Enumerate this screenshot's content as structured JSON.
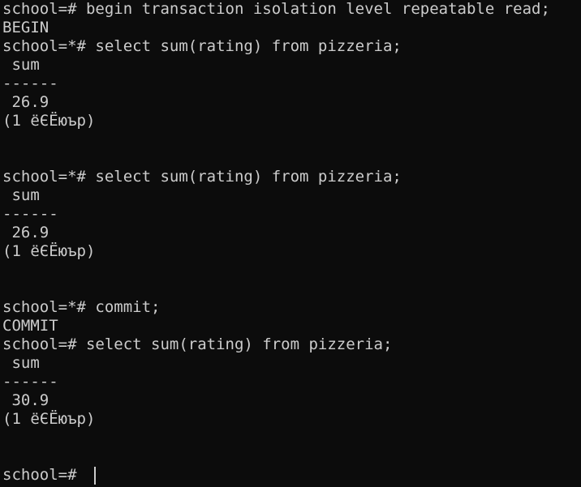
{
  "terminal": {
    "lines": [
      "school=# begin transaction isolation level repeatable read;",
      "BEGIN",
      "school=*# select sum(rating) from pizzeria;",
      " sum",
      "------",
      " 26.9",
      "(1 ёЄЁюър)",
      "",
      "",
      "school=*# select sum(rating) from pizzeria;",
      " sum",
      "------",
      " 26.9",
      "(1 ёЄЁюър)",
      "",
      "",
      "school=*# commit;",
      "COMMIT",
      "school=# select sum(rating) from pizzeria;",
      " sum",
      "------",
      " 30.9",
      "(1 ёЄЁюър)",
      "",
      "",
      "school=# "
    ]
  },
  "colors": {
    "background": "#0c0c0c",
    "foreground": "#cccccc"
  }
}
